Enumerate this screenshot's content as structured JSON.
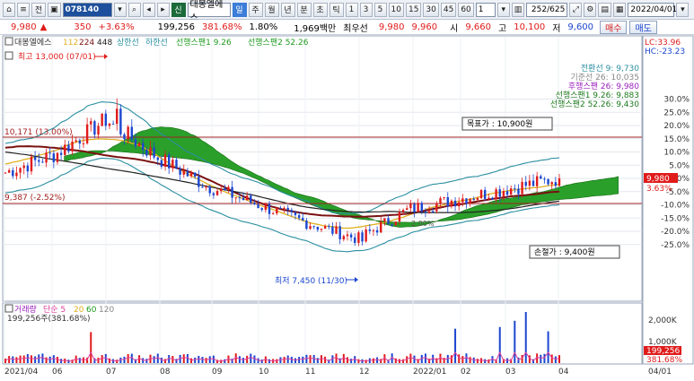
{
  "toolbar": {
    "mode_label": "전",
    "code": "078140",
    "tag_credit": "신",
    "stock_name": "대봉엘에스",
    "tag_mode": "일",
    "periods": [
      "주",
      "월",
      "년",
      "분",
      "초",
      "틱"
    ],
    "intervals": [
      "1",
      "3",
      "5",
      "10",
      "15",
      "30",
      "45",
      "60"
    ],
    "count_select": "1",
    "page_count": "252/625",
    "date": "2022/04/01"
  },
  "quote": {
    "price": "9,980",
    "arrow": "▲",
    "change": "350",
    "change_pct": "+3.63%",
    "volume": "199,256",
    "volume_ratio": "381.68%",
    "turnover": "1.80%",
    "amount": "1,969백만",
    "best_bid_label": "최우선",
    "best_ask": "9,980",
    "best_bid": "9,960",
    "open_label": "시",
    "open": "9,660",
    "high_label": "고",
    "high": "10,100",
    "low_label": "저",
    "low": "9,600",
    "buy_label": "매수",
    "sell_label": "매도"
  },
  "price_panel": {
    "legend_name": "대봉엘에스",
    "legend_items": [
      "112",
      "224",
      "448",
      "상한선",
      "하한선",
      "선행스팬1 9.26",
      "선행스팬2 52.26"
    ],
    "high_annotation": "최고 13,000 (07/01)",
    "low_annotation": "최저 7,450 (11/30)",
    "level_upper_label": "10,171 (13.00%)",
    "level_lower_label": "9,387 (-2.52%)",
    "target_label": "목표가 : 10,900원",
    "stop_label": "손절가 : 9,400원",
    "mid_label": "2.00%",
    "indicator_labels": [
      "전환선 9: 9,730",
      "기준선 26: 10,035",
      "후행스팬 26: 9,980",
      "선행스팬1 9.26: 9,883",
      "선행스팬2 52.26: 9,430"
    ],
    "lc_label": "LC:33.96",
    "hc_label": "HC:-23.23",
    "y_ticks": [
      "30.0%",
      "25.0%",
      "20.0%",
      "15.0%",
      "10.0%",
      "5.0%",
      "0.0%",
      "-5.0%",
      "-10.0%",
      "-15.0%",
      "-20.0%",
      "-25.0%"
    ],
    "price_tag": "9,980",
    "pct_tag": "3.63%"
  },
  "volume_panel": {
    "legend_items": [
      "거래량",
      "단순 5",
      "20",
      "60",
      "120"
    ],
    "last_volume": "199,256주(381.68%)",
    "y_ticks": [
      "2,000K",
      "1,000K"
    ],
    "vol_tag": "199,256",
    "vol_pct_tag": "381.68%"
  },
  "x_axis": {
    "labels": [
      "2021/04",
      "06",
      "07",
      "08",
      "09",
      "10",
      "11",
      "12",
      "2022/01",
      "02",
      "03",
      "04"
    ],
    "right_label": "04/01"
  },
  "colors": {
    "cloud": "#1f9a1f",
    "ma_long": "#7a1010",
    "ma_mid": "#e0b020",
    "band": "#2a8fa0",
    "up": "#e01b1b",
    "down": "#1b46d0",
    "level_line": "#a02020"
  },
  "chart_data": {
    "type": "candlestick",
    "x": [
      "2021/04",
      "06",
      "07",
      "08",
      "09",
      "10",
      "11",
      "12",
      "2022/01",
      "02",
      "03",
      "04"
    ],
    "close": [
      10200,
      10900,
      12200,
      10800,
      9700,
      9000,
      8300,
      7700,
      8800,
      9200,
      9600,
      9980
    ],
    "period_high": 13000,
    "period_low": 7450,
    "last": 9980
  }
}
